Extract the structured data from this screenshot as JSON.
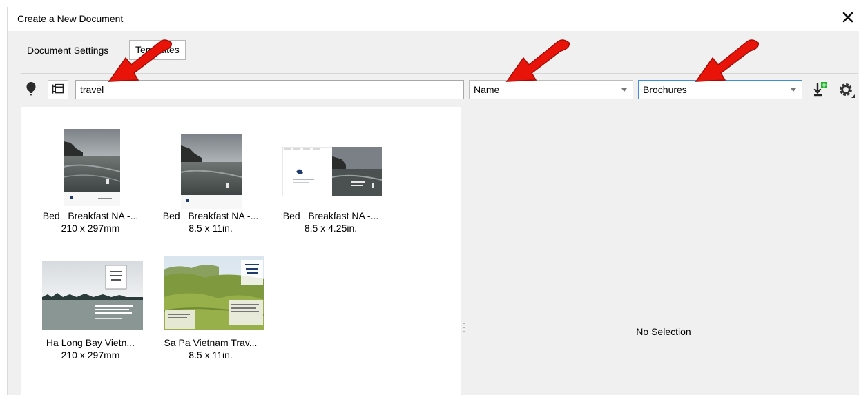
{
  "window": {
    "title": "Create a New Document"
  },
  "tabs": [
    {
      "label": "Document Settings"
    },
    {
      "label": "Templates"
    }
  ],
  "toolbar": {
    "search_value": "travel",
    "sort_value": "Name",
    "category_value": "Brochures"
  },
  "templates": [
    {
      "name": "Bed _Breakfast NA -...",
      "size": "210 x 297mm"
    },
    {
      "name": "Bed _Breakfast NA -...",
      "size": "8.5 x 11in."
    },
    {
      "name": "Bed _Breakfast NA -...",
      "size": "8.5 x 4.25in."
    },
    {
      "name": "Ha Long Bay Vietn...",
      "size": "210 x 297mm"
    },
    {
      "name": "Sa Pa Vietnam Trav...",
      "size": "8.5 x 11in."
    }
  ],
  "preview": {
    "status": "No Selection"
  },
  "colors": {
    "accent": "#3b8fdc",
    "annotation_arrow": "#e8140a"
  }
}
